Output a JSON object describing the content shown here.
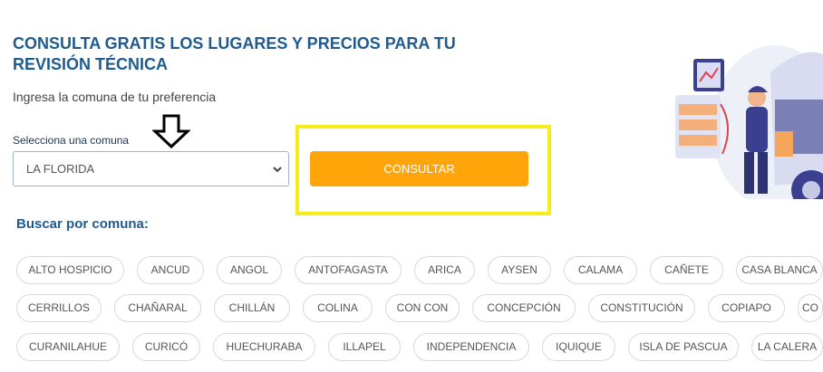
{
  "header": {
    "title": "CONSULTA GRATIS LOS LUGARES Y PRECIOS PARA TU REVISIÓN TÉCNICA",
    "subtitle": "Ingresa la comuna de tu preferencia"
  },
  "form": {
    "select_label": "Selecciona una comuna",
    "selected_value": "LA FLORIDA",
    "button_label": "CONSULTAR"
  },
  "colors": {
    "title_blue": "#1f5b8e",
    "button_orange": "#ffa50a",
    "highlight_yellow": "#f5ed1a"
  },
  "icons": [
    "down-arrow-icon",
    "chevron-down-icon",
    "mechanic-illustration"
  ],
  "browse": {
    "title": "Buscar por comuna:",
    "rows": [
      [
        "ALTO HOSPICIO",
        "ANCUD",
        "ANGOL",
        "ANTOFAGASTA",
        "ARICA",
        "AYSEN",
        "CALAMA",
        "CAÑETE",
        "CASA BLANCA"
      ],
      [
        "CERRILLOS",
        "CHAÑARAL",
        "CHILLÁN",
        "COLINA",
        "CON CON",
        "CONCEPCIÓN",
        "CONSTITUCIÓN",
        "COPIAPO",
        "CO"
      ],
      [
        "CURANILAHUE",
        "CURICÓ",
        "HUECHURABA",
        "ILLAPEL",
        "INDEPENDENCIA",
        "IQUIQUE",
        "ISLA DE PASCUA",
        "LA CALERA"
      ]
    ]
  }
}
